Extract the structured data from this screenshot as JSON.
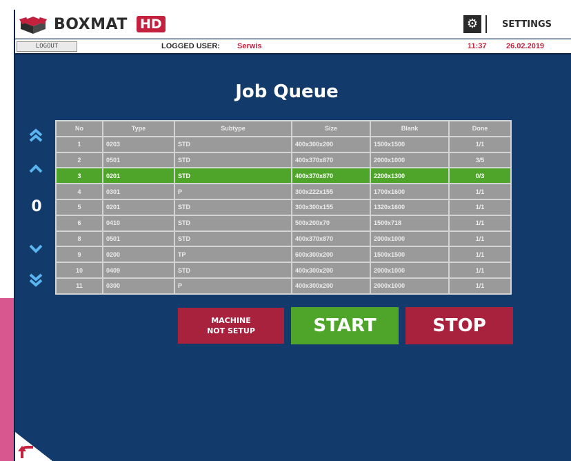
{
  "header": {
    "brand": "BOXMAT",
    "brand_badge": "HD",
    "settings_label": "SETTINGS",
    "settings_icon": "gear-icon"
  },
  "status": {
    "logout_label": "LOGOUT",
    "logged_label": "LOGGED USER:",
    "user": "Serwis",
    "time": "11:37",
    "date": "26.02.2019"
  },
  "title": "Job Queue",
  "counter": "0",
  "table": {
    "columns": [
      "No",
      "Type",
      "Subtype",
      "Size",
      "Blank",
      "Done"
    ],
    "rows": [
      [
        "1",
        "0203",
        "STD",
        "400x300x200",
        "1500x1500",
        "1/1"
      ],
      [
        "2",
        "0501",
        "STD",
        "400x370x870",
        "2000x1000",
        "3/5"
      ],
      [
        "3",
        "0201",
        "STD",
        "400x370x870",
        "2200x1300",
        "0/3"
      ],
      [
        "4",
        "0301",
        "P",
        "300x222x155",
        "1700x1600",
        "1/1"
      ],
      [
        "5",
        "0201",
        "STD",
        "300x300x155",
        "1320x1600",
        "1/1"
      ],
      [
        "6",
        "0410",
        "STD",
        "500x200x70",
        "1500x718",
        "1/1"
      ],
      [
        "8",
        "0501",
        "STD",
        "400x370x870",
        "2000x1000",
        "1/1"
      ],
      [
        "9",
        "0200",
        "TP",
        "600x300x200",
        "1500x1500",
        "1/1"
      ],
      [
        "10",
        "0409",
        "STD",
        "400x300x200",
        "2000x1000",
        "1/1"
      ],
      [
        "11",
        "0300",
        "P",
        "400x300x200",
        "2000x1000",
        "1/1"
      ]
    ],
    "selected_row_index": 2
  },
  "buttons": {
    "setup": [
      "MACHINE",
      "NOT SETUP"
    ],
    "start": "START",
    "stop": "STOP"
  },
  "colors": {
    "background": "#123a6a",
    "accent_red": "#a8213d",
    "accent_green": "#4ea52a",
    "table_grey": "#9a9a9a"
  }
}
